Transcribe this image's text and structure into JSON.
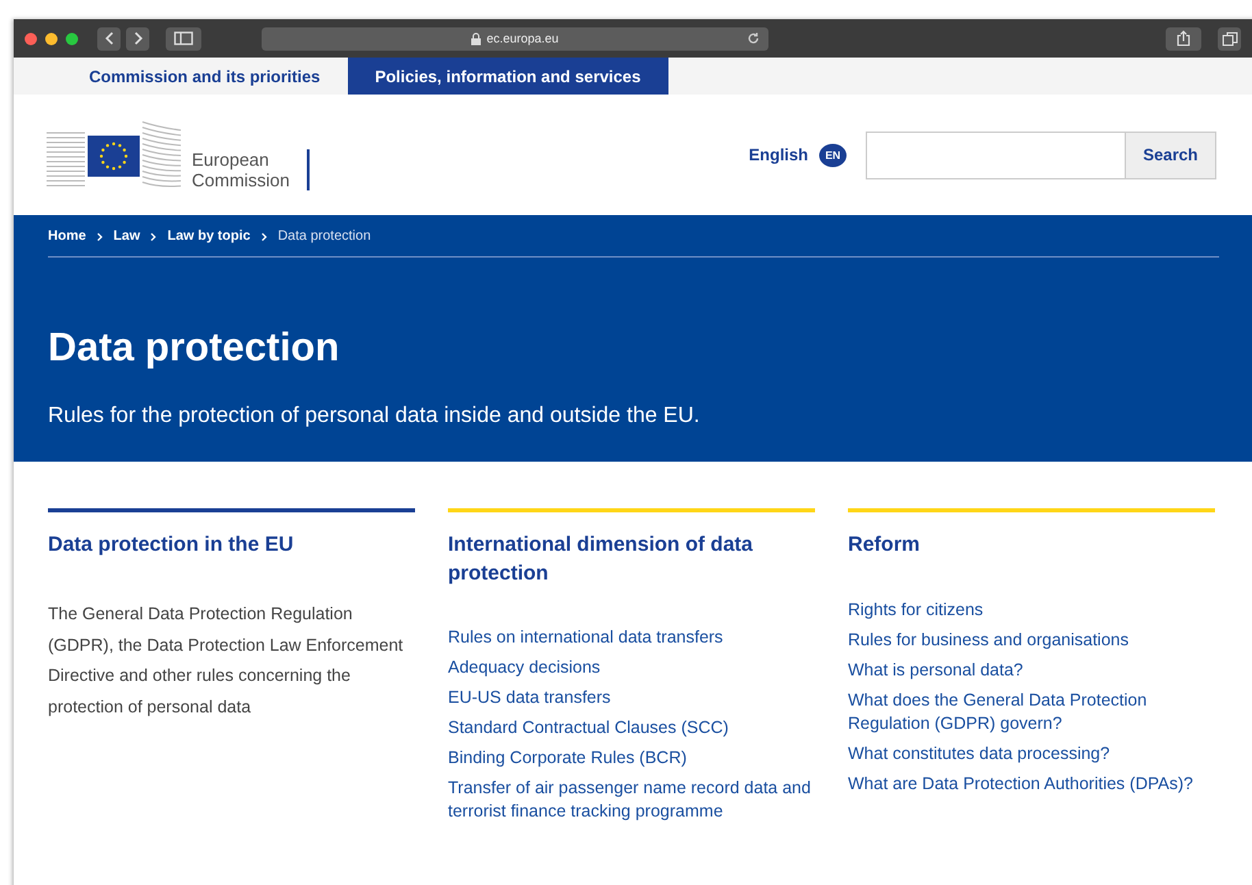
{
  "browser": {
    "address": "ec.europa.eu"
  },
  "top_tabs": [
    {
      "label": "Commission and its priorities",
      "selected": false
    },
    {
      "label": "Policies, information and services",
      "selected": true
    }
  ],
  "logo": {
    "line_1": "European",
    "line_2": "Commission"
  },
  "language": {
    "label": "English",
    "code": "EN"
  },
  "search": {
    "button": "Search"
  },
  "breadcrumbs": [
    {
      "label": "Home",
      "current": false
    },
    {
      "label": "Law",
      "current": false
    },
    {
      "label": "Law by topic",
      "current": false
    },
    {
      "label": "Data protection",
      "current": true
    }
  ],
  "page_title": "Data protection",
  "page_subtitle": "Rules for the protection of personal data inside and outside the EU.",
  "columns": [
    {
      "title": "Data protection in the EU",
      "color": "#1a3f94",
      "kind": "text",
      "text": "The General Data Protection Regulation (GDPR), the Data Protection Law Enforcement Directive and other rules concerning the protection of personal data"
    },
    {
      "title": "International dimension of data protection",
      "color": "#ffd617",
      "kind": "links",
      "links": [
        "Rules on international data transfers",
        "Adequacy decisions",
        "EU-US data transfers",
        "Standard Contractual Clauses (SCC)",
        "Binding Corporate Rules (BCR)",
        "Transfer of air passenger name record data and terrorist finance tracking programme"
      ]
    },
    {
      "title": "Reform",
      "color": "#ffd617",
      "kind": "links",
      "links": [
        "Rights for citizens",
        "Rules for business and organisations",
        "What is personal data?",
        "What does the General Data Protection Regulation (GDPR) govern?",
        "What constitutes data processing?",
        "What are Data Protection Authorities (DPAs)?"
      ]
    }
  ]
}
